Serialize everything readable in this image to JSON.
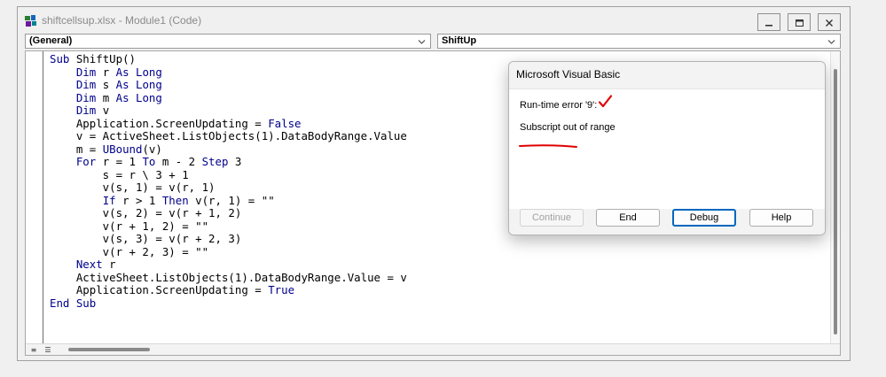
{
  "window": {
    "title": "shiftcellsup.xlsx - Module1 (Code)"
  },
  "editor": {
    "object_combo": "(General)",
    "procedure_combo": "ShiftUp",
    "code_lines": [
      [
        {
          "t": "Sub",
          "k": true
        },
        {
          "t": " ShiftUp()"
        }
      ],
      [
        {
          "t": "    "
        },
        {
          "t": "Dim",
          "k": true
        },
        {
          "t": " r "
        },
        {
          "t": "As Long",
          "k": true
        }
      ],
      [
        {
          "t": "    "
        },
        {
          "t": "Dim",
          "k": true
        },
        {
          "t": " s "
        },
        {
          "t": "As Long",
          "k": true
        }
      ],
      [
        {
          "t": "    "
        },
        {
          "t": "Dim",
          "k": true
        },
        {
          "t": " m "
        },
        {
          "t": "As Long",
          "k": true
        }
      ],
      [
        {
          "t": "    "
        },
        {
          "t": "Dim",
          "k": true
        },
        {
          "t": " v"
        }
      ],
      [
        {
          "t": "    Application.ScreenUpdating = "
        },
        {
          "t": "False",
          "k": true
        }
      ],
      [
        {
          "t": "    v = ActiveSheet.ListObjects(1).DataBodyRange.Value"
        }
      ],
      [
        {
          "t": "    m = "
        },
        {
          "t": "UBound",
          "k": true
        },
        {
          "t": "(v)"
        }
      ],
      [
        {
          "t": "    "
        },
        {
          "t": "For",
          "k": true
        },
        {
          "t": " r = 1 "
        },
        {
          "t": "To",
          "k": true
        },
        {
          "t": " m - 2 "
        },
        {
          "t": "Step",
          "k": true
        },
        {
          "t": " 3"
        }
      ],
      [
        {
          "t": "        s = r \\ 3 + 1"
        }
      ],
      [
        {
          "t": "        v(s, 1) = v(r, 1)"
        }
      ],
      [
        {
          "t": "        "
        },
        {
          "t": "If",
          "k": true
        },
        {
          "t": " r > 1 "
        },
        {
          "t": "Then",
          "k": true
        },
        {
          "t": " v(r, 1) = \"\""
        }
      ],
      [
        {
          "t": "        v(s, 2) = v(r + 1, 2)"
        }
      ],
      [
        {
          "t": "        v(r + 1, 2) = \"\""
        }
      ],
      [
        {
          "t": "        v(s, 3) = v(r + 2, 3)"
        }
      ],
      [
        {
          "t": "        v(r + 2, 3) = \"\""
        }
      ],
      [
        {
          "t": "    "
        },
        {
          "t": "Next",
          "k": true
        },
        {
          "t": " r"
        }
      ],
      [
        {
          "t": "    ActiveSheet.ListObjects(1).DataBodyRange.Value = v"
        }
      ],
      [
        {
          "t": "    Application.ScreenUpdating = "
        },
        {
          "t": "True",
          "k": true
        }
      ],
      [
        {
          "t": "End Sub",
          "k": true
        }
      ]
    ]
  },
  "dialog": {
    "title": "Microsoft Visual Basic",
    "error_code": "Run-time error '9':",
    "error_message": "Subscript out of range",
    "buttons": {
      "continue": "Continue",
      "end": "End",
      "debug": "Debug",
      "help": "Help"
    }
  },
  "colors": {
    "keyword": "#00008b",
    "annotation": "#e00000",
    "default_button_border": "#0067c0"
  },
  "icons": {
    "app": "vba-module-icon",
    "minimize": "minimize-icon",
    "restore": "restore-icon",
    "close": "close-icon",
    "annotation_check": "red-checkmark-icon",
    "annotation_underline": "red-underline"
  }
}
